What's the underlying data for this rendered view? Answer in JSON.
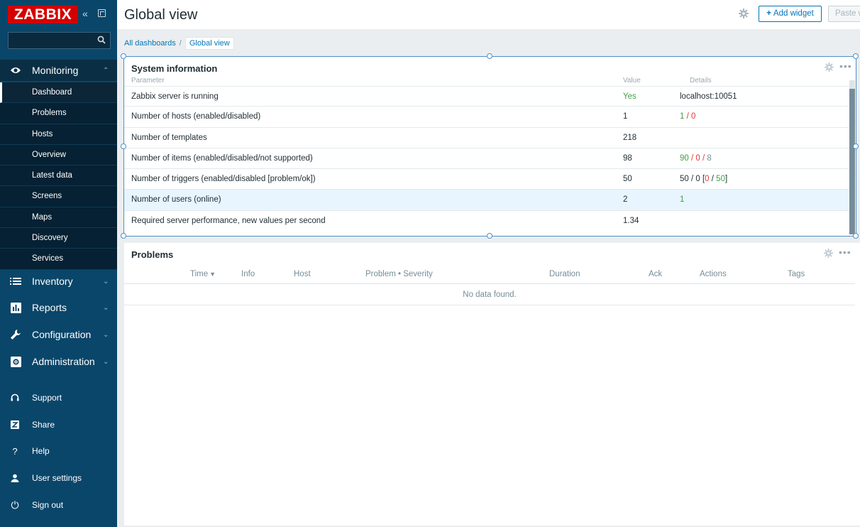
{
  "sidebar": {
    "logo": "ZABBIX",
    "collapse_glyph": "«",
    "search": {
      "value": "",
      "placeholder": ""
    },
    "monitoring": {
      "label": "Monitoring",
      "caret": "⌃",
      "items": [
        "Dashboard",
        "Problems",
        "Hosts",
        "Overview",
        "Latest data",
        "Screens",
        "Maps",
        "Discovery",
        "Services"
      ]
    },
    "sections": [
      {
        "label": "Inventory",
        "icon": "list-icon"
      },
      {
        "label": "Reports",
        "icon": "bar-chart-icon"
      },
      {
        "label": "Configuration",
        "icon": "wrench-icon"
      },
      {
        "label": "Administration",
        "icon": "admin-gear-icon"
      }
    ],
    "section_caret": "⌄",
    "bottom": [
      {
        "label": "Support",
        "icon": "headset-icon"
      },
      {
        "label": "Share",
        "icon": "share-z-icon"
      },
      {
        "label": "Help",
        "icon": "help-icon",
        "glyph": "?"
      },
      {
        "label": "User settings",
        "icon": "user-icon"
      },
      {
        "label": "Sign out",
        "icon": "power-icon",
        "glyph": "⏻"
      }
    ]
  },
  "header": {
    "title": "Global view",
    "add_widget_label": "Add widget",
    "add_widget_plus": "+",
    "paste_label": "Paste w"
  },
  "breadcrumbs": {
    "all": "All dashboards",
    "sep": "/",
    "current": "Global view"
  },
  "system_info": {
    "title": "System information",
    "hidden_headers": [
      "Parameter",
      "Value",
      "Details"
    ],
    "rows": [
      {
        "param": "Zabbix server is running",
        "value": "Yes",
        "details": "localhost:10051"
      },
      {
        "param": "Number of hosts (enabled/disabled)",
        "value": "1",
        "details_parts": [
          "1",
          " / ",
          "0"
        ]
      },
      {
        "param": "Number of templates",
        "value": "218",
        "details": ""
      },
      {
        "param": "Number of items (enabled/disabled/not supported)",
        "value": "98",
        "details_parts": [
          "90",
          " / ",
          "0",
          " / ",
          "8"
        ]
      },
      {
        "param": "Number of triggers (enabled/disabled [problem/ok])",
        "value": "50",
        "details_parts": [
          "50 / 0 [",
          "0",
          " / ",
          "50",
          "]"
        ]
      },
      {
        "param": "Number of users (online)",
        "value": "2",
        "details": "1"
      },
      {
        "param": "Required server performance, new values per second",
        "value": "1.34",
        "details": ""
      }
    ]
  },
  "problems": {
    "title": "Problems",
    "columns": [
      "Time",
      "Info",
      "Host",
      "Problem • Severity",
      "Duration",
      "Ack",
      "Actions",
      "Tags"
    ],
    "sort_caret": "▼",
    "empty_message": "No data found."
  },
  "widget_dots": "•••",
  "colors": {
    "sidebar_bg": "#0a466a",
    "logo_red": "#d40000",
    "link_blue": "#0275b8",
    "ok_green": "#429e47",
    "problem_red": "#e33734",
    "selection_blue": "#4f8fc8"
  }
}
